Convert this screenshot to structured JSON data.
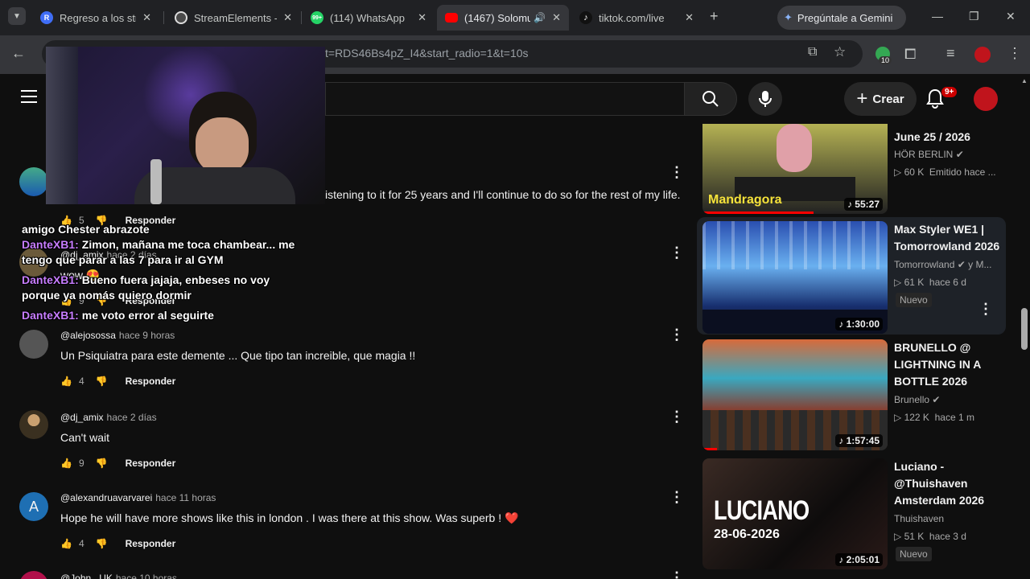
{
  "browser": {
    "tabs": [
      {
        "title": "Regreso a los stre",
        "fav_color": "#3f6df5",
        "fav_text": "R"
      },
      {
        "title": "StreamElements -",
        "fav_color": "#4a4a4a",
        "fav_text": ""
      },
      {
        "title": "(114) WhatsApp",
        "fav_color": "#25d366",
        "fav_text": "99+"
      },
      {
        "title": "(1467) Solomu",
        "fav_color": "#ff0000",
        "fav_text": ""
      },
      {
        "title": "tiktok.com/live",
        "fav_color": "#111111",
        "fav_text": ""
      }
    ],
    "gemini_label": "Pregúntale a Gemini",
    "url_fragment": "t=RDS46Bs4pZ_I4&start_radio=1&t=10s",
    "extension_badge": "10"
  },
  "youtube": {
    "create_label": "Crear",
    "notifications_badge": "9+"
  },
  "comments": [
    {
      "author": "",
      "time": "",
      "text": "istening to it for 25 years and I'll continue to do so for the rest of my life.",
      "likes": "5",
      "reply": "Responder",
      "avatar_color": "#3a6ea5"
    },
    {
      "author": "@dj_amix",
      "time": "hace 2 días",
      "text": "wow 😍",
      "likes": "9",
      "reply": "Responder",
      "avatar_color": "#6b5a3a"
    },
    {
      "author": "@alejosossa",
      "time": "hace 9 horas",
      "text": "Un Psiquiatra para este demente ... Que tipo tan increible, que magia !!",
      "likes": "4",
      "reply": "Responder",
      "avatar_color": "#555"
    },
    {
      "author": "@dj_amix",
      "time": "hace 2 días",
      "text": "Can't wait",
      "likes": "9",
      "reply": "Responder",
      "avatar_color": "#6b5a3a"
    },
    {
      "author": "@alexandruavarvarei",
      "time": "hace 11 horas",
      "text": "Hope  he will have more shows like this in london . I was there at this show. Was superb ! ❤️",
      "likes": "4",
      "reply": "Responder",
      "avatar_color": "#1e6fb3",
      "avatar_letter": "A"
    },
    {
      "author": "@John...UK",
      "time": "hace 10 horas",
      "text": "",
      "likes": "",
      "reply": "",
      "avatar_color": "#b0104a"
    }
  ],
  "chat": [
    {
      "user": "",
      "text": "amigo Chester abrazote"
    },
    {
      "user": "DanteXB1:",
      "text": "Zimon, mañana me toca chambear... me tengo que parar a las 7 para ir al GYM"
    },
    {
      "user": "DanteXB1:",
      "text": "Bueno fuera jajaja, enbeses no voy porque ya nomás quiero dormir"
    },
    {
      "user": "DanteXB1:",
      "text": "me voto error al seguirte"
    }
  ],
  "recommendations": [
    {
      "title": "June 25 / 2026",
      "channel": "HÖR BERLIN",
      "verified": true,
      "views": "60 K",
      "when": "Emitido hace ...",
      "duration": "55:27",
      "badge": "",
      "thumb_label": "Mandragora"
    },
    {
      "title": "Max Styler WE1 | Tomorrowland 2026",
      "channel": "Tomorrowland",
      "verified": true,
      "channel_extra": "y M...",
      "views": "61 K",
      "when": "hace 6 d",
      "duration": "1:30:00",
      "badge": "Nuevo",
      "thumb_label": ""
    },
    {
      "title": "BRUNELLO @ LIGHTNING IN A BOTTLE 2026",
      "channel": "Brunello",
      "verified": true,
      "views": "122 K",
      "when": "hace 1 m",
      "duration": "1:57:45",
      "badge": "",
      "thumb_label": ""
    },
    {
      "title": "Luciano - @Thuishaven Amsterdam 2026",
      "channel": "Thuishaven",
      "verified": false,
      "views": "51 K",
      "when": "hace 3 d",
      "duration": "2:05:01",
      "badge": "Nuevo",
      "thumb_label": "LUCIANO",
      "thumb_sub": "28-06-2026"
    }
  ]
}
